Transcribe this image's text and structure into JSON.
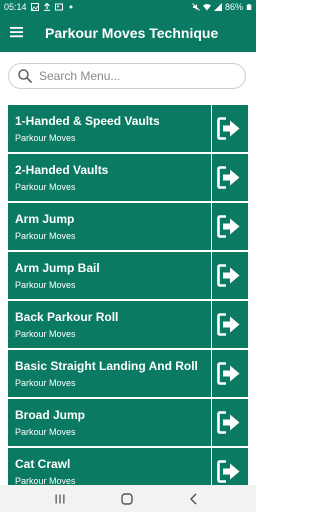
{
  "status_bar": {
    "time": "05:14",
    "battery_percent": "86%",
    "left_icons": [
      "gallery-icon",
      "upload-icon",
      "image-icon",
      "dot-icon"
    ],
    "right_icons": [
      "mute-icon",
      "wifi-icon",
      "signal-icon",
      "battery-icon"
    ]
  },
  "app_bar": {
    "title": "Parkour Moves Technique",
    "background": "#0b7a62",
    "menu_icon": "hamburger-menu-icon"
  },
  "search": {
    "placeholder": "Search Menu...",
    "value": "",
    "icon": "search-icon"
  },
  "list": {
    "item_background": "#0b7a62",
    "item_text_color": "#ffffff",
    "action_icon": "exit-arrow-icon",
    "items": [
      {
        "title": "1-Handed & Speed Vaults",
        "subtitle": "Parkour Moves"
      },
      {
        "title": "2-Handed Vaults",
        "subtitle": "Parkour Moves"
      },
      {
        "title": "Arm Jump",
        "subtitle": "Parkour Moves"
      },
      {
        "title": "Arm Jump Bail",
        "subtitle": "Parkour Moves"
      },
      {
        "title": "Back Parkour Roll",
        "subtitle": "Parkour Moves"
      },
      {
        "title": "Basic Straight Landing And Roll",
        "subtitle": "Parkour Moves"
      },
      {
        "title": "Broad Jump",
        "subtitle": "Parkour Moves"
      },
      {
        "title": "Cat Crawl",
        "subtitle": "Parkour Moves"
      }
    ]
  },
  "nav_bar": {
    "buttons": [
      "recents-icon",
      "home-icon",
      "back-icon"
    ]
  }
}
